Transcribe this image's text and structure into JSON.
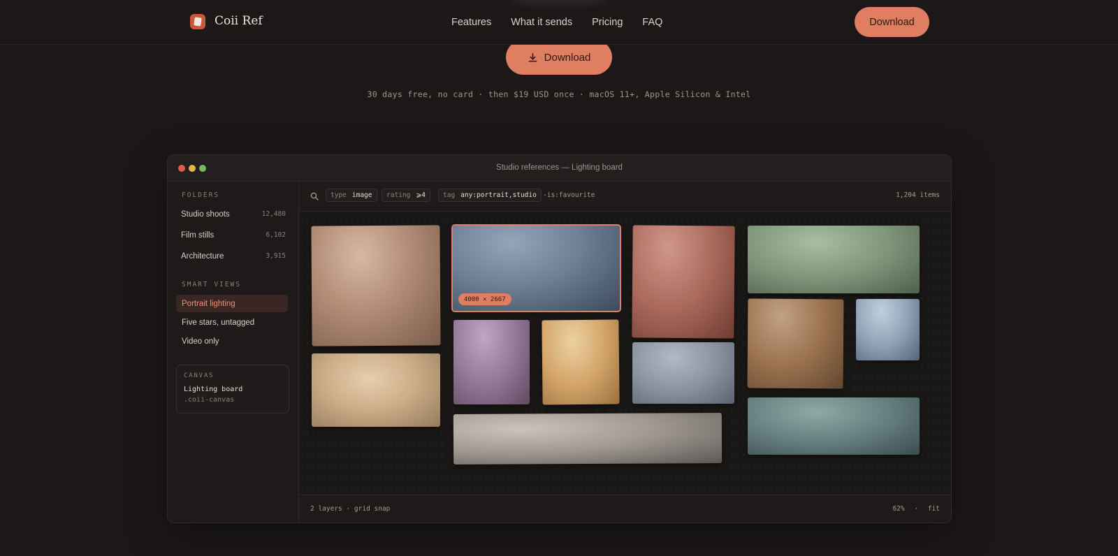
{
  "nav": {
    "brand": "Coii Ref",
    "links": [
      "Features",
      "What it sends",
      "Pricing",
      "FAQ"
    ],
    "download_label": "Download"
  },
  "hero": {
    "download_label": "Download",
    "tagline": "30 days free, no card · then $19 USD once · macOS 11+, Apple Silicon & Intel"
  },
  "window": {
    "title": "Studio references — Lighting board"
  },
  "sidebar": {
    "folders_label": "FOLDERS",
    "folders": [
      {
        "name": "Studio shoots",
        "count": "12,480"
      },
      {
        "name": "Film stills",
        "count": "6,102"
      },
      {
        "name": "Architecture",
        "count": "3,915"
      }
    ],
    "smart_views_label": "SMART VIEWS",
    "smart_views": [
      "Portrait lighting",
      "Five stars, untagged",
      "Video only"
    ],
    "canvas": {
      "label": "CANVAS",
      "name": "Lighting board",
      "extension": ".coii-canvas"
    }
  },
  "query": {
    "chips": [
      {
        "key": "type",
        "value": "image"
      },
      {
        "key": "rating",
        "value": "⩾4"
      },
      {
        "key": "tag",
        "value": "any:portrait,studio"
      }
    ],
    "negation": "-is:favourite",
    "item_count": "1,204 items"
  },
  "board": {
    "selected_dimensions": "4000 × 2667"
  },
  "footer": {
    "left": "2 layers · grid snap",
    "zoom": "62%",
    "separator": "·",
    "fit": "fit"
  }
}
